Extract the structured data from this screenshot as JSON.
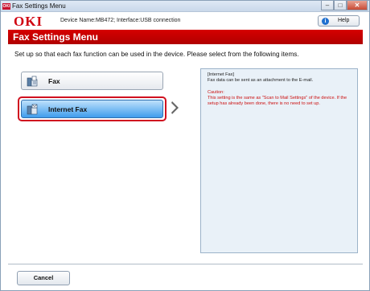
{
  "window": {
    "title": "Fax Settings Menu",
    "app_icon_text": "OKI",
    "controls": [
      "minimize",
      "maximize",
      "close"
    ]
  },
  "header": {
    "logo": "OKI",
    "device_info": "Device Name:MB472; Interface:USB connection",
    "help_label": "Help"
  },
  "banner": {
    "title": "Fax Settings Menu"
  },
  "instruction": "Set up so that each fax function can be used in the device. Please select from the following items.",
  "options": [
    {
      "label": "Fax",
      "icon": "fax-machine-icon",
      "selected": false
    },
    {
      "label": "Internet Fax",
      "icon": "internet-fax-icon",
      "selected": true
    }
  ],
  "description": {
    "header": "[Internet Fax]",
    "line1": "Fax data can be sent as an attachment to the E-mail.",
    "caution_label": "Caution:",
    "caution_text": "This setting is the same as \"Scan to Mail Settings\" of the device. If the setup has already been done, there is no need to set up."
  },
  "footer": {
    "cancel_label": "Cancel"
  },
  "colors": {
    "accent_red": "#d00010",
    "selected_blue": "#3f9ded",
    "panel_bg": "#e9f1f8"
  }
}
